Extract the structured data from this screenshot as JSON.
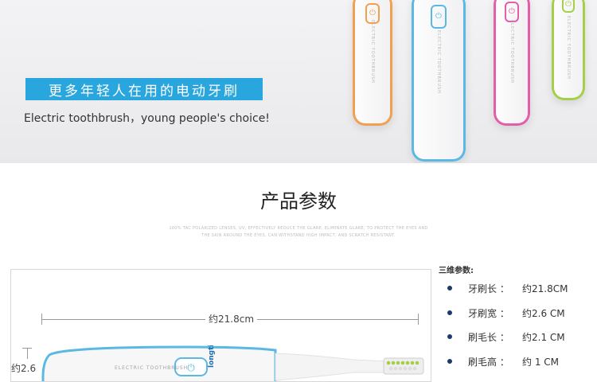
{
  "hero": {
    "banner": "更多年轻人在用的电动牙刷",
    "tagline": "Electric toothbrush，young people's choice!",
    "brushes": [
      {
        "name": "orange",
        "color": "#f0a050",
        "text": "ELECTRIC TOOTHBRUSH"
      },
      {
        "name": "blue",
        "color": "#5bb8e3",
        "text": "ELECTRIC TOOTHBRUSH"
      },
      {
        "name": "pink",
        "color": "#e25ea8",
        "text": "ELECTRIC TOOTHBRUSH"
      },
      {
        "name": "green",
        "color": "#a5cf4a",
        "text": "ELECTRIC TOOTHBRUSH"
      }
    ]
  },
  "params": {
    "title": "产品参数",
    "fine_print_1": "100% TAC POLARIZED LENSES, UV, EFFECTIVELY REDUCE THE GLARE, ELIMINATE GLARE, TO PROTECT THE EYES AND",
    "fine_print_2": "THE SKIN AROUND THE EYES, CAN WITHSTAND HIGH IMPACT, AND SCRATCH RESISTANT."
  },
  "diagram": {
    "length_label": "约21.8cm",
    "width_label": "约2.6",
    "brush_text": "ELECTRIC TOOTHBRUSH",
    "brand": "longtio"
  },
  "specs": {
    "title": "三维参数:",
    "rows": [
      {
        "key": "牙刷长 ：",
        "value": "约21.8CM"
      },
      {
        "key": "牙刷宽 ：",
        "value": "约2.6  CM"
      },
      {
        "key": "刷毛长 ：",
        "value": "约2.1  CM"
      },
      {
        "key": "刷毛高 ：",
        "value": "约  1  CM"
      }
    ]
  },
  "colors": {
    "accent": "#2aa6df",
    "bullet": "#1c3a6b"
  }
}
